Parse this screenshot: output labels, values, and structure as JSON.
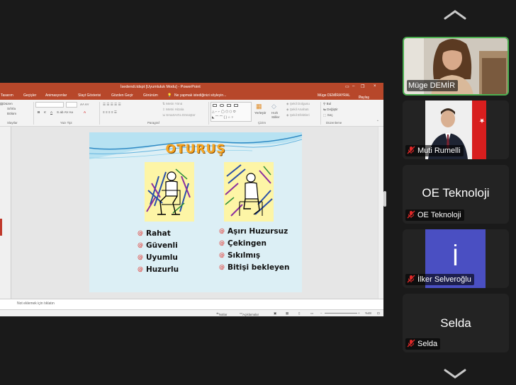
{
  "ppt": {
    "window_title": "İsedendi.tdspt [Uyumluluk Modu] - PowerPoint",
    "tabs": [
      "Tasarım",
      "Geçişler",
      "Animasyonlar",
      "Slayt Gösterisi",
      "Gözden Geçir",
      "Görünüm"
    ],
    "tell_me": "Ne yapmak istediğinizi söyleyin...",
    "user": "Müge DEMİRAYRAL",
    "share": "Paylaş",
    "groups": {
      "slides": "Slaytlar",
      "font": "Yazı Tipi",
      "paragraph": "Paragraf",
      "drawing": "Çizim",
      "editing": "Düzenleme"
    },
    "ribbon_left": [
      "Düzen",
      "Sıfırla",
      "Bölüm"
    ],
    "ribbon_para": [
      "Metin Yönü",
      "Metni Hizala",
      "SmartArt'a Dönüştür"
    ],
    "ribbon_draw": [
      "Şekil Dolgusu",
      "Şekil Anahatı",
      "Şekil Efektleri"
    ],
    "arrange": "Yerleştir",
    "quick_styles": "Hızlı Stiller",
    "editing": [
      "Bul",
      "Değiştir",
      "Seç"
    ],
    "notes_placeholder": "Not eklemek için tıklatın",
    "status": {
      "notes": "Notlar",
      "comments": "Açıklamalar",
      "zoom": "%48"
    }
  },
  "slide": {
    "title": "OTURUŞ",
    "left_bullets": [
      "Rahat",
      "Güvenli",
      "Uyumlu",
      "Huzurlu"
    ],
    "right_bullets": [
      "Aşırı Huzursuz",
      "Çekingen",
      "Sıkılmış",
      "Bitişi bekleyen"
    ],
    "bullet_glyph": "@",
    "accent": "#f6a623",
    "pic_bg": "#fdf5a6"
  },
  "participants": [
    {
      "name": "Müge DEMİR",
      "video": true,
      "muted": false,
      "active": true
    },
    {
      "name": "Muti Rumelli",
      "video": true,
      "muted": true
    },
    {
      "name": "OE Teknoloji",
      "display": "OE Teknoloji",
      "video": false,
      "muted": true
    },
    {
      "name": "İlker Selveroğlu",
      "display": "İ",
      "video": false,
      "muted": true
    },
    {
      "name": "Selda",
      "display": "Selda",
      "video": false,
      "muted": true
    }
  ],
  "nav": {
    "up_icon": "chevron-up-icon",
    "down_icon": "chevron-down-icon"
  },
  "colors": {
    "ppt_red": "#b7472a",
    "active_border": "#4caf50",
    "muted_red": "#e02828"
  }
}
